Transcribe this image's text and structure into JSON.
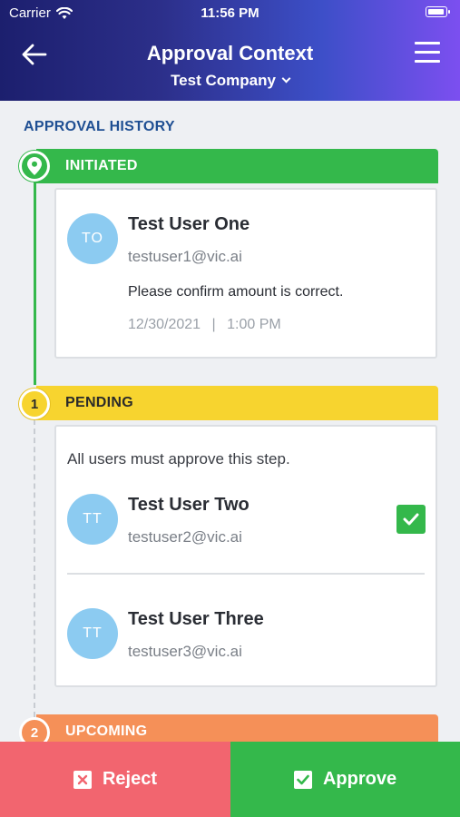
{
  "status_bar": {
    "carrier": "Carrier",
    "time": "11:56 PM"
  },
  "header": {
    "title": "Approval Context",
    "company": "Test Company"
  },
  "section_title": "APPROVAL HISTORY",
  "steps": [
    {
      "label": "INITIATED",
      "badge_icon": "location-pin-icon",
      "color": "#34b84b",
      "entry": {
        "initials": "TO",
        "name": "Test User One",
        "email": "testuser1@vic.ai",
        "comment": "Please confirm amount is correct.",
        "date": "12/30/2021",
        "separator": "|",
        "time": "1:00 PM"
      }
    },
    {
      "number": "1",
      "label": "PENDING",
      "color": "#f7d42f",
      "rule": "All users must approve this step.",
      "users": [
        {
          "initials": "TT",
          "name": "Test User Two",
          "email": "testuser2@vic.ai",
          "approved": true
        },
        {
          "initials": "TT",
          "name": "Test User Three",
          "email": "testuser3@vic.ai",
          "approved": false
        }
      ]
    },
    {
      "number": "2",
      "label": "UPCOMING",
      "color": "#f59058"
    }
  ],
  "actions": {
    "reject": "Reject",
    "approve": "Approve",
    "reject_color": "#f2656f",
    "approve_color": "#34b84b"
  }
}
